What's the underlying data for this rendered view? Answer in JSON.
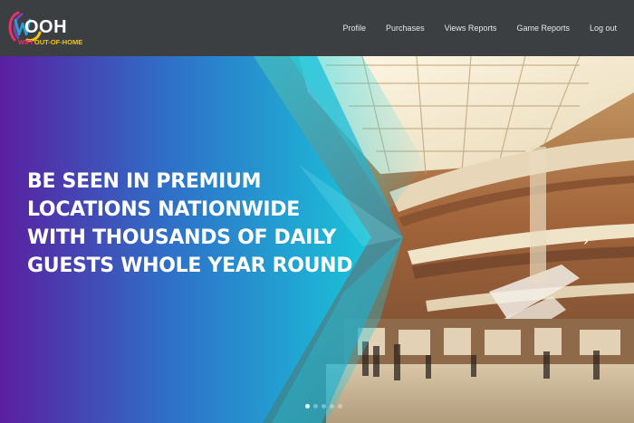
{
  "brand": {
    "logo_text": "OOH",
    "logo_sub_wifi": "WIFI",
    "logo_sub_rest": " OUT-OF-HOME",
    "colors": {
      "pink": "#e8336a",
      "purple": "#7b3fb0",
      "blue": "#2a9fd8",
      "yellow": "#f2c318"
    }
  },
  "nav": {
    "items": [
      {
        "label": "Profile"
      },
      {
        "label": "Purchases"
      },
      {
        "label": "Views Reports"
      },
      {
        "label": "Game Reports"
      },
      {
        "label": "Log out"
      }
    ]
  },
  "hero": {
    "headline_lines": [
      "BE SEEN IN PREMIUM",
      "LOCATIONS NATIONWIDE",
      "WITH THOUSANDS OF DAILY",
      "GUESTS WHOLE YEAR ROUND"
    ],
    "next_icon": "chevron-right-icon",
    "slide_count": 5,
    "active_slide": 1,
    "gradient": {
      "start": "#5a1fa0",
      "mid": "#2f6fc8",
      "end": "#19c4d8"
    }
  }
}
